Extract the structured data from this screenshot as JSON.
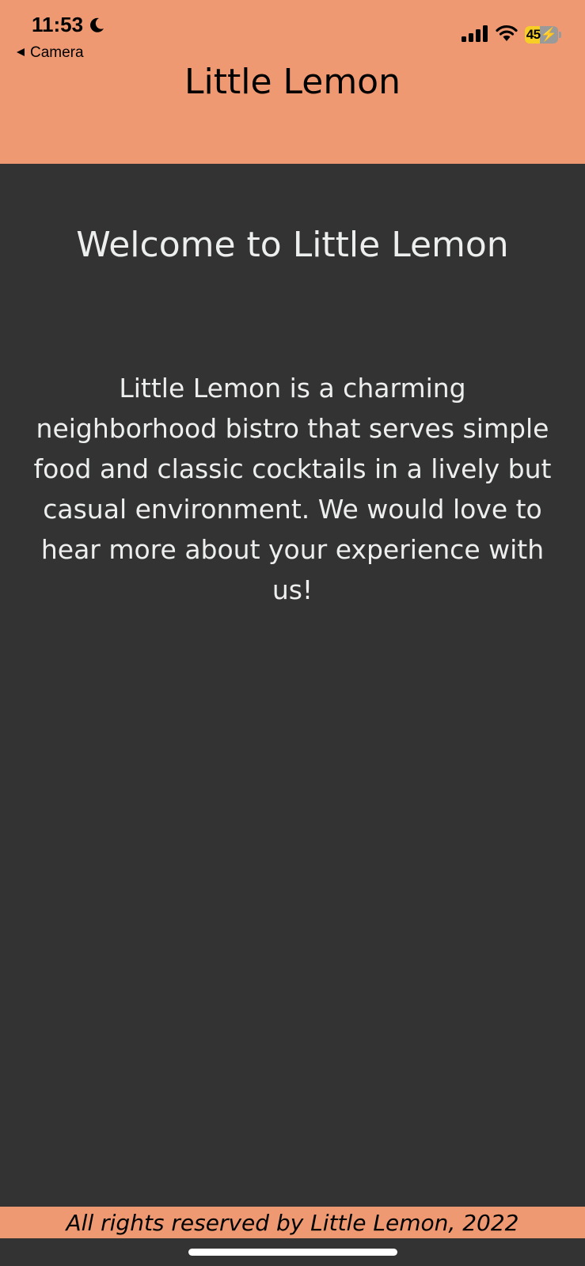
{
  "status_bar": {
    "time": "11:53",
    "back_label": "Camera",
    "battery_level": "45",
    "icons": [
      "moon-icon",
      "signal-icon",
      "wifi-icon",
      "battery-charging-icon",
      "back-arrow-icon"
    ]
  },
  "header": {
    "title": "Little Lemon"
  },
  "main": {
    "heading": "Welcome to Little Lemon",
    "body": "Little Lemon is a charming neighborhood bistro that serves simple food and classic cocktails in a lively but casual environment. We would love to hear more about your experience with us!"
  },
  "footer": {
    "text": "All rights reserved by Little Lemon, 2022"
  },
  "colors": {
    "header_bg": "#EE9972",
    "content_bg": "#333333",
    "content_text": "#EDEFEE",
    "battery_fill": "#F7CE25"
  }
}
